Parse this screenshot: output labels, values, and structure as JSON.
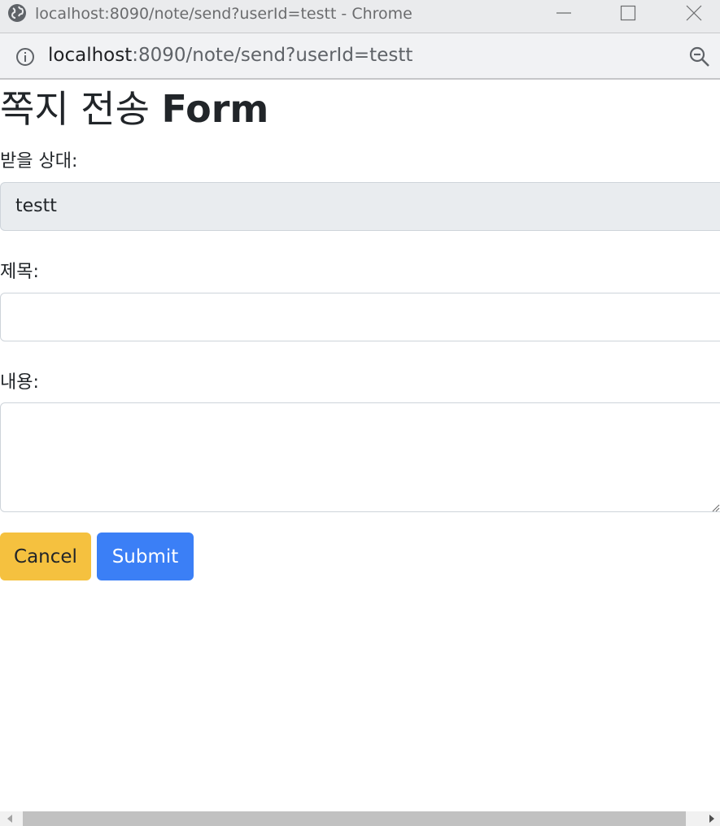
{
  "window": {
    "title": "localhost:8090/note/send?userId=testt - Chrome"
  },
  "addressbar": {
    "url_host": "localhost",
    "url_rest": ":8090/note/send?userId=testt"
  },
  "page": {
    "heading_prefix": "쪽지 전송 ",
    "heading_bold": "Form",
    "recipient": {
      "label": "받을 상대:",
      "value": "testt"
    },
    "subject": {
      "label": "제목:",
      "value": ""
    },
    "content": {
      "label": "내용:",
      "value": ""
    },
    "buttons": {
      "cancel_label": "Cancel",
      "submit_label": "Submit"
    }
  },
  "colors": {
    "cancel_button": "#f5c13f",
    "submit_button": "#3b7ff6",
    "readonly_field": "#e9ecef"
  },
  "icons": [
    "globe-icon",
    "minimize-icon",
    "maximize-icon",
    "close-icon",
    "info-icon",
    "zoom-out-icon",
    "resize-grip-icon",
    "scroll-left-arrow-icon",
    "scroll-right-arrow-icon"
  ]
}
